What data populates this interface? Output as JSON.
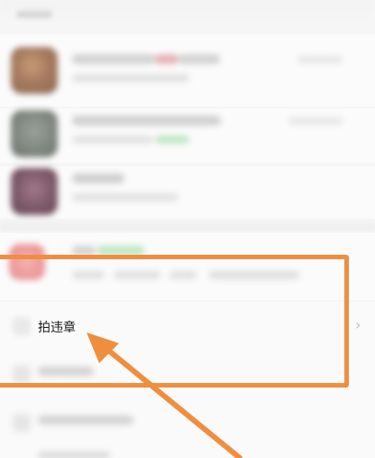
{
  "menu": {
    "violation_item": {
      "label": "拍违章",
      "icon": "camera-icon",
      "chevron": "›"
    }
  },
  "annotation": {
    "color": "#ef8e3f"
  }
}
